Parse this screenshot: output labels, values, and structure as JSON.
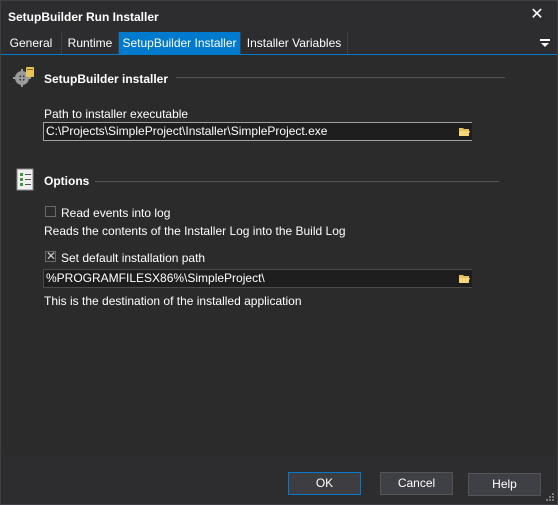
{
  "window": {
    "title": "SetupBuilder Run Installer",
    "close_icon": "close-icon"
  },
  "tabs": [
    {
      "label": "General",
      "active": false
    },
    {
      "label": "Runtime",
      "active": false
    },
    {
      "label": "SetupBuilder Installer",
      "active": true
    },
    {
      "label": "Installer Variables",
      "active": false
    }
  ],
  "installer_section": {
    "title": "SetupBuilder installer",
    "icon": "gear-installer-icon",
    "path_label": "Path to installer executable",
    "path_value": "C:\\Projects\\SimpleProject\\Installer\\SimpleProject.exe"
  },
  "options_section": {
    "title": "Options",
    "icon": "checklist-icon",
    "read_events": {
      "label": "Read events into log",
      "checked": false,
      "description": "Reads the contents of the Installer Log into the Build Log"
    },
    "default_path": {
      "label": "Set default installation path",
      "checked": true,
      "value": "%PROGRAMFILESX86%\\SimpleProject\\",
      "description": "This is the destination of the installed application"
    }
  },
  "buttons": {
    "ok": "OK",
    "cancel": "Cancel",
    "help": "Help"
  },
  "colors": {
    "accent": "#007acc",
    "background": "#2b2b2b",
    "folder_icon": "#e8c35a"
  }
}
